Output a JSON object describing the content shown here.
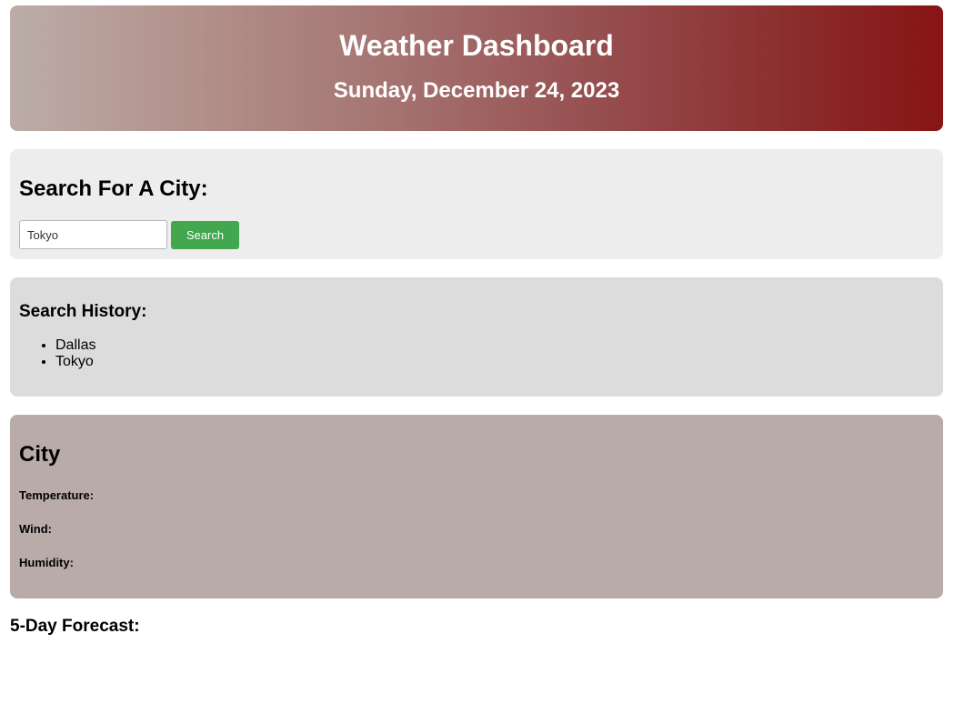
{
  "header": {
    "title": "Weather Dashboard",
    "date": "Sunday, December 24, 2023"
  },
  "search": {
    "heading": "Search For A City:",
    "input_value": "Tokyo",
    "button_label": "Search"
  },
  "history": {
    "heading": "Search History:",
    "items": [
      "Dallas",
      "Tokyo"
    ]
  },
  "current": {
    "city": "City",
    "temperature_label": "Temperature:",
    "wind_label": "Wind:",
    "humidity_label": "Humidity:"
  },
  "forecast": {
    "heading": "5-Day Forecast:"
  },
  "colors": {
    "header_gradient_start": "#bbada8",
    "header_gradient_end": "#881414",
    "search_button": "#42a74e",
    "search_panel": "#ededed",
    "history_panel": "#dcdcdc",
    "city_panel": "#b9aca8"
  }
}
